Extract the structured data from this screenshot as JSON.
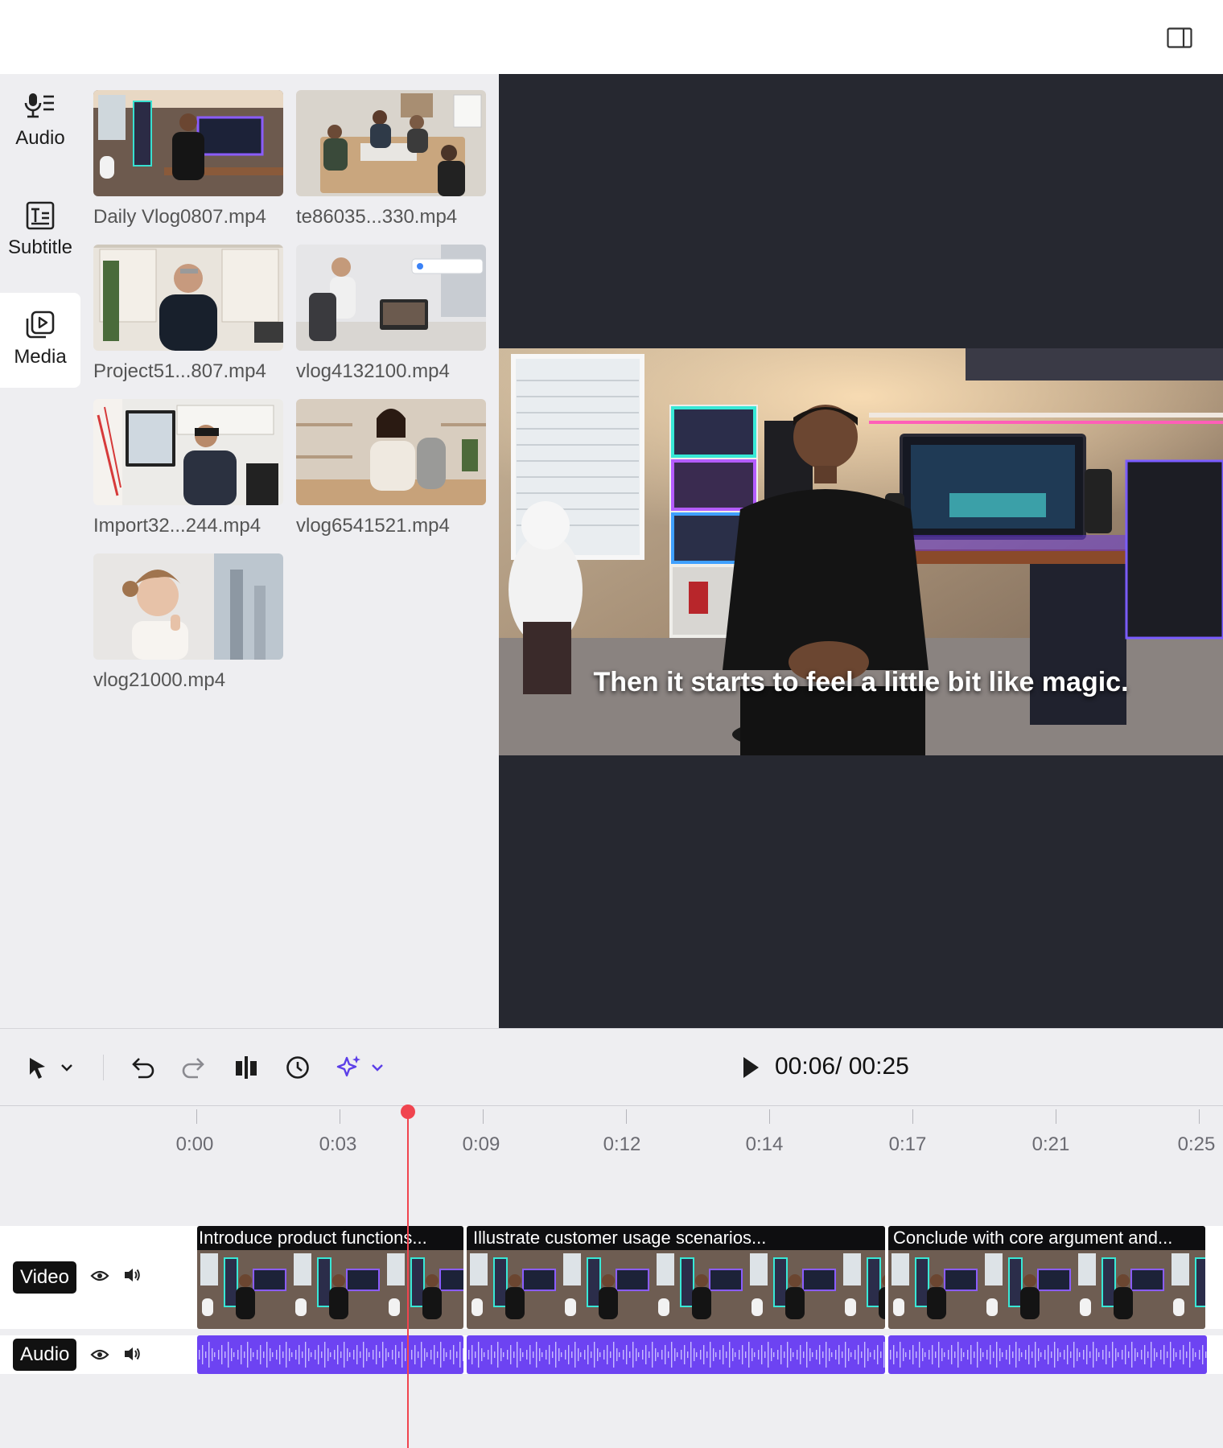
{
  "nav": {
    "items": [
      {
        "label": "Audio",
        "icon": "mic-list-icon"
      },
      {
        "label": "Subtitle",
        "icon": "subtitle-icon"
      },
      {
        "label": "Media",
        "icon": "media-play-icon"
      }
    ],
    "active": "Media"
  },
  "media": {
    "items": [
      {
        "name": "Daily Vlog0807.mp4"
      },
      {
        "name": "te86035...330.mp4"
      },
      {
        "name": "Project51...807.mp4"
      },
      {
        "name": "vlog4132100.mp4"
      },
      {
        "name": "Import32...244.mp4"
      },
      {
        "name": "vlog6541521.mp4"
      },
      {
        "name": "vlog21000.mp4"
      }
    ]
  },
  "preview": {
    "caption": "Then it starts to feel a little bit like magic."
  },
  "toolbar": {
    "timecode": "00:06/ 00:25",
    "icons": [
      "select-arrow-icon",
      "chevron-down-icon",
      "undo-icon",
      "redo-icon",
      "split-icon",
      "speed-icon",
      "ai-sparkle-icon",
      "play-icon"
    ]
  },
  "ruler": {
    "labels": [
      "0:00",
      "0:03",
      "0:09",
      "0:12",
      "0:14",
      "0:17",
      "0:21",
      "0:25"
    ]
  },
  "tracks": {
    "video": {
      "label": "Video",
      "clips": [
        {
          "title": "Introduce product functions..."
        },
        {
          "title": "Illustrate customer usage scenarios..."
        },
        {
          "title": "Conclude with core argument and..."
        }
      ]
    },
    "audio": {
      "label": "Audio"
    }
  },
  "colors": {
    "accent": "#6d43f2",
    "playhead": "#f0444f",
    "preview_bg": "#262830"
  }
}
